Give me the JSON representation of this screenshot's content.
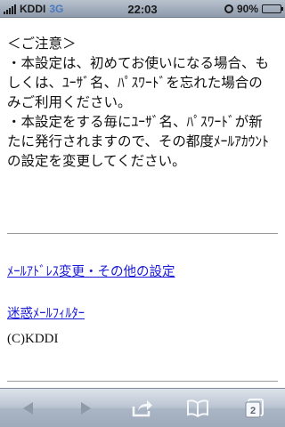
{
  "status_bar": {
    "carrier": "KDDI",
    "network": "3G",
    "time": "22:03",
    "battery_percent_text": "90%",
    "battery_level": 0.9
  },
  "notice": {
    "lines": [
      "＜ご注意＞",
      "・本設定は、初めてお使いになる場合、も",
      "しくは、ﾕｰｻﾞ名、ﾊﾟｽﾜｰﾄﾞを忘れた場合の",
      "みご利用ください。",
      "・本設定をする毎にﾕｰｻﾞ名、ﾊﾟｽﾜｰﾄﾞが新",
      "たに発行されますので、その都度ﾒｰﾙｱｶｳﾝﾄ",
      "の設定を変更してください。"
    ]
  },
  "links": {
    "mail_address_change": "ﾒｰﾙｱﾄﾞﾚｽ変更・その他の設定",
    "spam_filter": "迷惑ﾒｰﾙﾌｨﾙﾀｰ"
  },
  "footer": {
    "copyright": "(C)KDDI"
  },
  "toolbar": {
    "back_icon": "back-arrow-icon",
    "forward_icon": "forward-arrow-icon",
    "share_icon": "share-icon",
    "bookmarks_icon": "book-icon",
    "pages_count": "2"
  }
}
